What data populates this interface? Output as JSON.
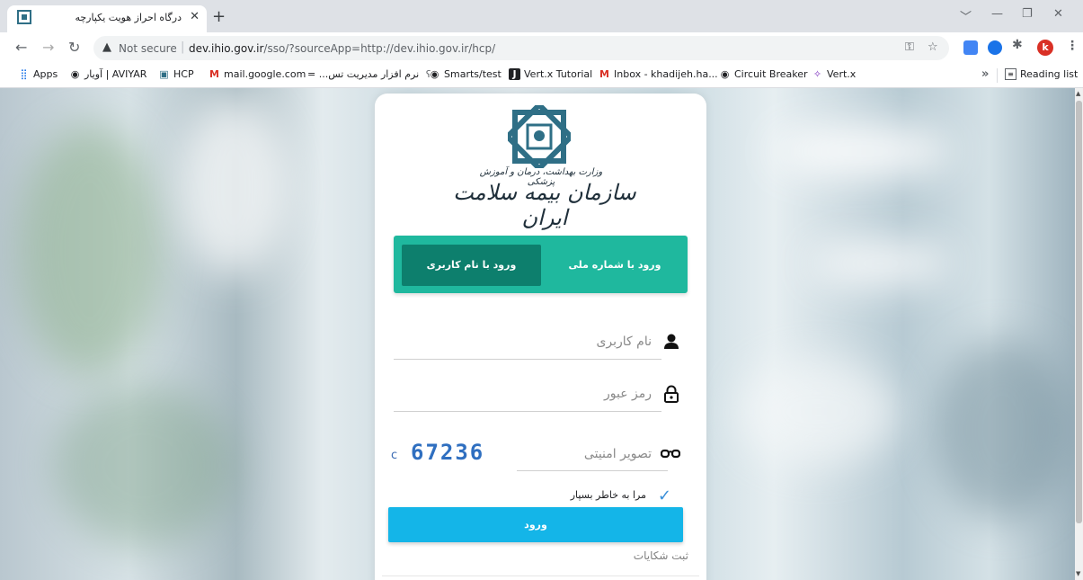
{
  "browser": {
    "tab_title": "درگاه احراز هویت یکپارچه",
    "tab_close": "✕",
    "new_tab": "+",
    "window_controls": [
      "﹀",
      "—",
      "❐",
      "✕"
    ],
    "security_label": "Not secure",
    "url_host": "dev.ihio.gov.ir",
    "url_rest": "/sso/?sourceApp=http://dev.ihio.gov.ir/hcp/",
    "avatar_letter": "k"
  },
  "bookmarks": {
    "items": [
      {
        "label": "Apps",
        "icon": "apps-grid-icon"
      },
      {
        "label": "آویار | AVIYAR",
        "icon": "globe-icon"
      },
      {
        "label": "HCP",
        "icon": "ihio-icon"
      },
      {
        "label": "mail.google.com",
        "icon": "gmail-icon"
      },
      {
        "label": "نرم افزار مدیریت تس... =",
        "icon": "app-icon"
      },
      {
        "label": "Smarts/test",
        "icon": "globe-icon"
      },
      {
        "label": "Vert.x Tutorial",
        "icon": "j-icon"
      },
      {
        "label": "Inbox - khadijeh.ha...",
        "icon": "gmail-icon"
      },
      {
        "label": "Circuit Breaker",
        "icon": "globe-icon"
      },
      {
        "label": "Vert.x",
        "icon": "vertx-icon"
      }
    ],
    "overflow": "»",
    "reading_list": "Reading list"
  },
  "login": {
    "logo_subtitle": "وزارت بهداشت، درمان و آموزش پزشکی",
    "logo_title": "سازمان بیمه سلامت ایران",
    "tab_national_id": "ورود با شماره ملی",
    "tab_username": "ورود با نام کاربری",
    "active_tab": "username",
    "username_placeholder": "نام کاربری",
    "password_placeholder": "رمز عبور",
    "captcha_placeholder": "تصویر امنیتی",
    "captcha_code": "67236",
    "captcha_refresh": "c",
    "remember_me": "مرا به خاطر بسپار",
    "remember_checked": true,
    "submit": "ورود",
    "complaints": "ثبت شکایات"
  },
  "colors": {
    "tab_bar": "#1fb89e",
    "tab_active": "#0d7f6d",
    "login_button": "#14b5e8",
    "logo_teal": "#2f6f86"
  }
}
